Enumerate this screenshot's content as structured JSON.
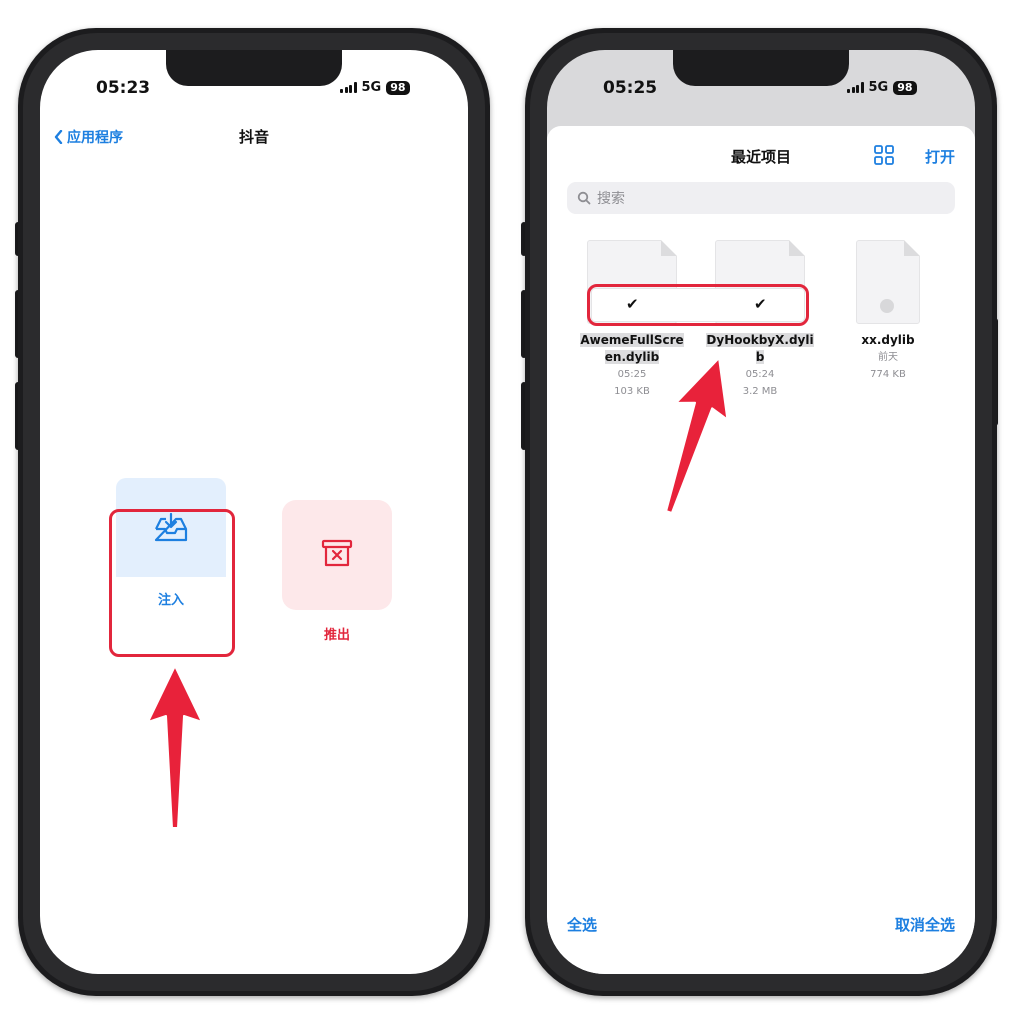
{
  "left_phone": {
    "status": {
      "time": "05:23",
      "network": "5G",
      "battery": "98"
    },
    "nav": {
      "back_label": "应用程序",
      "title": "抖音"
    },
    "actions": {
      "inject_label": "注入",
      "eject_label": "推出"
    }
  },
  "right_phone": {
    "status": {
      "time": "05:25",
      "network": "5G",
      "battery": "98"
    },
    "sheet": {
      "title": "最近项目",
      "open_label": "打开",
      "search_placeholder": "搜索"
    },
    "files": [
      {
        "name_line1": "AwemeFullScre",
        "name_line2": "en.dylib",
        "date": "05:25",
        "size": "103 KB",
        "selected": true
      },
      {
        "name_line1": "DyHookbyX.dyli",
        "name_line2": "b",
        "date": "05:24",
        "size": "3.2 MB",
        "selected": true
      },
      {
        "name_line1": "xx.dylib",
        "name_line2": "",
        "date": "前天",
        "size": "774 KB",
        "selected": false
      }
    ],
    "footer": {
      "select_all_label": "全选",
      "deselect_all_label": "取消全选"
    }
  },
  "colors": {
    "accent": "#1d7fe0",
    "danger": "#e2263c",
    "inject_bg": "#e3effd",
    "eject_bg": "#fde8ea"
  }
}
